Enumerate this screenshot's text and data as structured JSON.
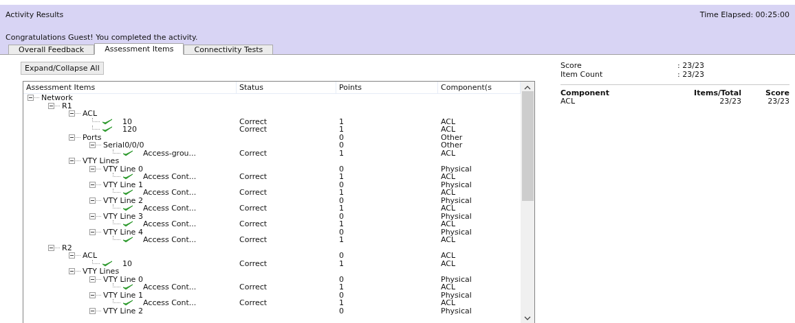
{
  "header": {
    "title": "Activity Results",
    "time_elapsed": "Time Elapsed: 00:25:00",
    "message": "Congratulations Guest! You completed the activity."
  },
  "tabs": [
    {
      "label": "Overall Feedback",
      "selected": false
    },
    {
      "label": "Assessment Items",
      "selected": true
    },
    {
      "label": "Connectivity Tests",
      "selected": false
    }
  ],
  "expand_button": "Expand/Collapse All",
  "table": {
    "columns": [
      "Assessment Items",
      "Status",
      "Points",
      "Component(s"
    ],
    "tree": [
      {
        "label": "Network",
        "expanded": true,
        "children": [
          {
            "label": "R1",
            "expanded": true,
            "children": [
              {
                "label": "ACL",
                "expanded": true,
                "children": [
                  {
                    "label": "10",
                    "checked": true,
                    "status": "Correct",
                    "points": "1",
                    "component": "ACL"
                  },
                  {
                    "label": "120",
                    "checked": true,
                    "status": "Correct",
                    "points": "1",
                    "component": "ACL"
                  }
                ]
              },
              {
                "label": "Ports",
                "expanded": true,
                "points": "0",
                "component": "Other",
                "children": [
                  {
                    "label": "Serial0/0/0",
                    "expanded": true,
                    "points": "0",
                    "component": "Other",
                    "children": [
                      {
                        "label": "Access-grou...",
                        "checked": true,
                        "status": "Correct",
                        "points": "1",
                        "component": "ACL"
                      }
                    ]
                  }
                ]
              },
              {
                "label": "VTY Lines",
                "expanded": true,
                "children": [
                  {
                    "label": "VTY Line 0",
                    "expanded": true,
                    "points": "0",
                    "component": "Physical",
                    "children": [
                      {
                        "label": "Access Cont...",
                        "checked": true,
                        "status": "Correct",
                        "points": "1",
                        "component": "ACL"
                      }
                    ]
                  },
                  {
                    "label": "VTY Line 1",
                    "expanded": true,
                    "points": "0",
                    "component": "Physical",
                    "children": [
                      {
                        "label": "Access Cont...",
                        "checked": true,
                        "status": "Correct",
                        "points": "1",
                        "component": "ACL"
                      }
                    ]
                  },
                  {
                    "label": "VTY Line 2",
                    "expanded": true,
                    "points": "0",
                    "component": "Physical",
                    "children": [
                      {
                        "label": "Access Cont...",
                        "checked": true,
                        "status": "Correct",
                        "points": "1",
                        "component": "ACL"
                      }
                    ]
                  },
                  {
                    "label": "VTY Line 3",
                    "expanded": true,
                    "points": "0",
                    "component": "Physical",
                    "children": [
                      {
                        "label": "Access Cont...",
                        "checked": true,
                        "status": "Correct",
                        "points": "1",
                        "component": "ACL"
                      }
                    ]
                  },
                  {
                    "label": "VTY Line 4",
                    "expanded": true,
                    "points": "0",
                    "component": "Physical",
                    "children": [
                      {
                        "label": "Access Cont...",
                        "checked": true,
                        "status": "Correct",
                        "points": "1",
                        "component": "ACL"
                      }
                    ]
                  }
                ]
              }
            ]
          },
          {
            "label": "R2",
            "expanded": true,
            "children": [
              {
                "label": "ACL",
                "expanded": true,
                "points": "0",
                "component": "ACL",
                "children": [
                  {
                    "label": "10",
                    "checked": true,
                    "status": "Correct",
                    "points": "1",
                    "component": "ACL"
                  }
                ]
              },
              {
                "label": "VTY Lines",
                "expanded": true,
                "children": [
                  {
                    "label": "VTY Line 0",
                    "expanded": true,
                    "points": "0",
                    "component": "Physical",
                    "children": [
                      {
                        "label": "Access Cont...",
                        "checked": true,
                        "status": "Correct",
                        "points": "1",
                        "component": "ACL"
                      }
                    ]
                  },
                  {
                    "label": "VTY Line 1",
                    "expanded": true,
                    "points": "0",
                    "component": "Physical",
                    "children": [
                      {
                        "label": "Access Cont...",
                        "checked": true,
                        "status": "Correct",
                        "points": "1",
                        "component": "ACL"
                      }
                    ]
                  },
                  {
                    "label": "VTY Line 2",
                    "expanded": true,
                    "points": "0",
                    "component": "Physical"
                  }
                ]
              }
            ]
          }
        ]
      }
    ]
  },
  "summary": {
    "rows": [
      {
        "label": "Score",
        "value": ": 23/23"
      },
      {
        "label": "Item Count",
        "value": ": 23/23"
      }
    ],
    "columns": [
      "Component",
      "Items/Total",
      "Score"
    ],
    "components": [
      {
        "component": "ACL",
        "items_total": "23/23",
        "score": "23/23"
      }
    ]
  }
}
